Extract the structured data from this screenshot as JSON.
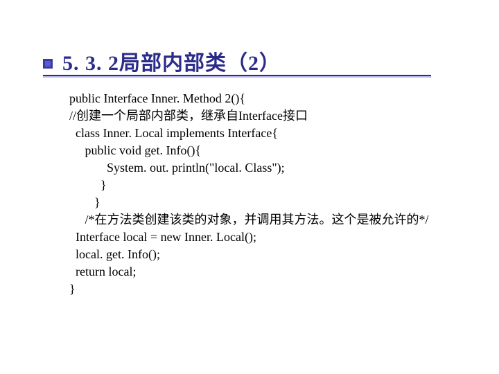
{
  "title": "5. 3. 2局部内部类（2）",
  "code": {
    "l1": "public Interface Inner. Method 2(){",
    "l2": "//创建一个局部内部类，继承自Interface接口",
    "l3": "  class Inner. Local implements Interface{",
    "l4": "     public void get. Info(){",
    "l5": "            System. out. println(\"local. Class\");",
    "l6": "          }",
    "l7": "        }",
    "l8": "     /*在方法类创建该类的对象，并调用其方法。这个是被允许的*/",
    "l9": "  Interface local = new Inner. Local();",
    "l10": "  local. get. Info();",
    "l11": "  return local;",
    "l12": "}"
  }
}
